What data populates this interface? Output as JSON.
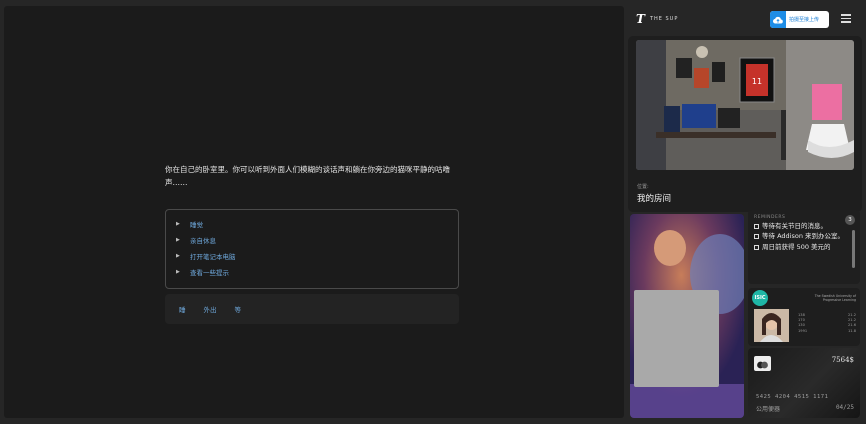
{
  "story": {
    "text": "你在自己的卧室里。你可以听到外面人们模糊的谈话声和躺在你旁边的猫咪平静的咕噜声……",
    "choices": [
      "睡觉",
      "亲自休息",
      "打开笔记本电脑",
      "查看一些提示"
    ],
    "actions": [
      "睡",
      "外出",
      "等"
    ]
  },
  "header": {
    "logo_mark": "T",
    "logo_text": "THE SUP",
    "upload_label": "拍摄至接上传"
  },
  "location": {
    "label": "位置:",
    "name": "我的房间"
  },
  "reminders": {
    "title": "REMINDERS",
    "count": "3",
    "items": [
      "等待有关节日的消息。",
      "等待 Addison 来到办公室。",
      "周日前获得 500 美元的"
    ]
  },
  "student_id": {
    "badge": "ISIC",
    "university": "The Swedish University of Progressive Learning",
    "rows": [
      [
        "138",
        "21.2"
      ],
      [
        "170",
        "21.2"
      ],
      [
        "130",
        "21.6"
      ],
      [
        "1991",
        "11.8"
      ]
    ]
  },
  "bank_card": {
    "balance": "7564$",
    "number": "5425 4204 4515 1171",
    "holder": "公用便器",
    "expiry": "04/25"
  },
  "colors": {
    "link": "#6fa9dd",
    "upload_accent": "#1e8de6",
    "isic_badge": "#1fb6a6"
  }
}
